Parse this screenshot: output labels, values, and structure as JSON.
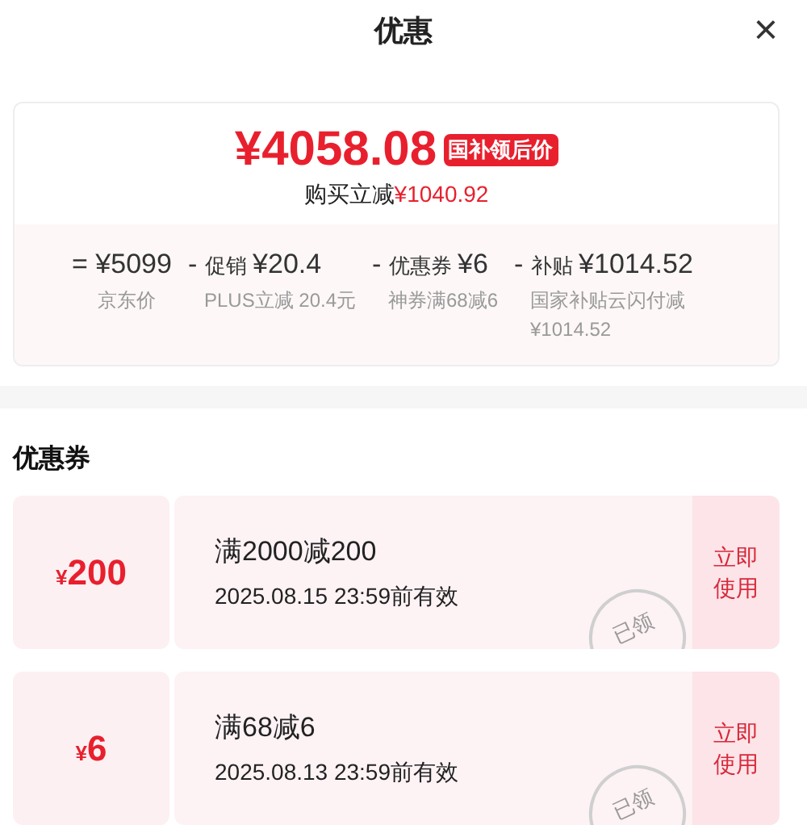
{
  "header": {
    "title": "优惠",
    "close": "×"
  },
  "summary": {
    "price": "¥4058.08",
    "badge": "国补领后价",
    "saving_label": "购买立减",
    "saving_amount": "¥1040.92",
    "breakdown": [
      {
        "op": "=",
        "amount": "¥5099",
        "note": "京东价"
      },
      {
        "op": "-",
        "label": "促销",
        "amount": "¥20.4",
        "note": "PLUS立减 20.4元"
      },
      {
        "op": "-",
        "label": "优惠券",
        "amount": "¥6",
        "note": "神券满68减6"
      },
      {
        "op": "-",
        "label": "补贴",
        "amount": "¥1014.52",
        "note": "国家补贴云闪付减¥1014.52"
      }
    ]
  },
  "coupons_section": {
    "title": "优惠券",
    "coupons": [
      {
        "amount": "200",
        "currency": "¥",
        "condition": "满2000减200",
        "validity": "2025.08.15 23:59前有效",
        "action": "立即使用",
        "claimed": true,
        "stamp": "已领"
      },
      {
        "amount": "6",
        "currency": "¥",
        "condition": "满68减6",
        "validity": "2025.08.13 23:59前有效",
        "action": "立即使用",
        "claimed": true,
        "stamp": "已领"
      }
    ]
  }
}
